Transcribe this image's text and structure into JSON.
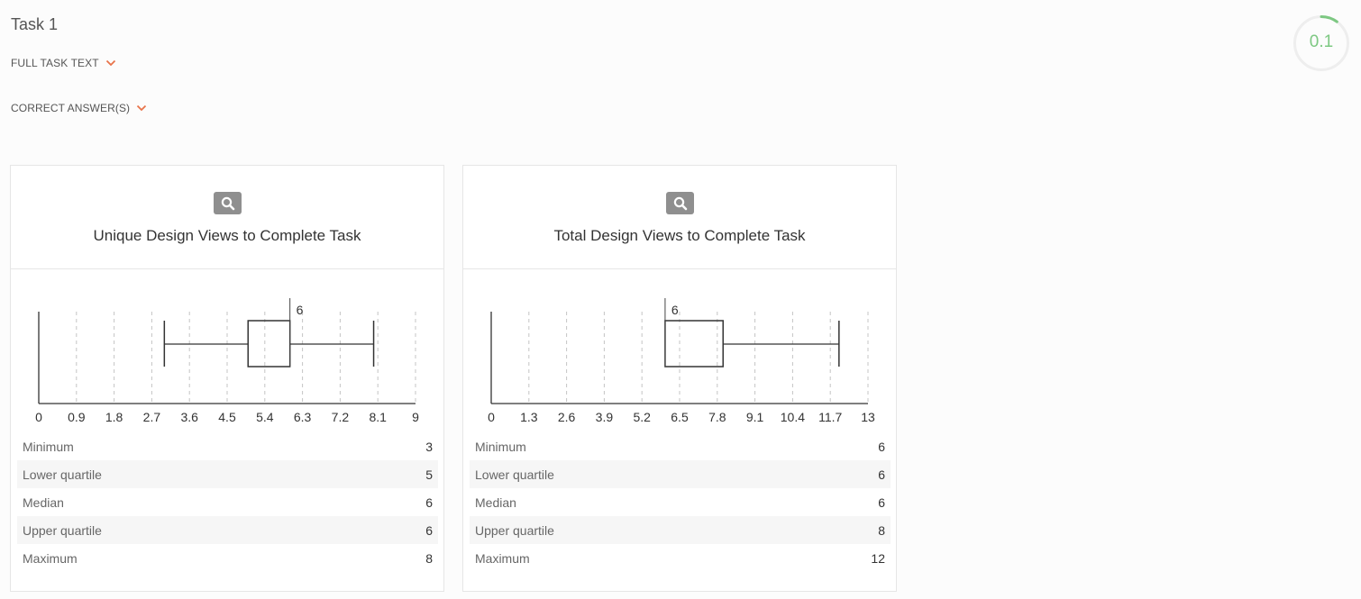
{
  "task": {
    "title": "Task 1",
    "full_task_text_label": "FULL TASK TEXT",
    "correct_answers_label": "CORRECT ANSWER(S)",
    "score": "0.1",
    "score_fraction": 0.1
  },
  "colors": {
    "accent": "#e8734a",
    "score": "#7dc882",
    "ring": "#eeeeee"
  },
  "cards": [
    {
      "title": "Unique Design Views to Complete Task",
      "zoom_icon": "search-icon",
      "stats": [
        {
          "label": "Minimum",
          "value": "3"
        },
        {
          "label": "Lower quartile",
          "value": "5"
        },
        {
          "label": "Median",
          "value": "6"
        },
        {
          "label": "Upper quartile",
          "value": "6"
        },
        {
          "label": "Maximum",
          "value": "8"
        }
      ]
    },
    {
      "title": "Total Design Views to Complete Task",
      "zoom_icon": "search-icon",
      "stats": [
        {
          "label": "Minimum",
          "value": "6"
        },
        {
          "label": "Lower quartile",
          "value": "6"
        },
        {
          "label": "Median",
          "value": "6"
        },
        {
          "label": "Upper quartile",
          "value": "8"
        },
        {
          "label": "Maximum",
          "value": "12"
        }
      ]
    }
  ],
  "chart_data": [
    {
      "type": "boxplot",
      "title": "Unique Design Views to Complete Task",
      "xlim": [
        0,
        9
      ],
      "ticks": [
        "0",
        "0.9",
        "1.8",
        "2.7",
        "3.6",
        "4.5",
        "5.4",
        "6.3",
        "7.2",
        "8.1",
        "9"
      ],
      "min": 3,
      "q1": 5,
      "median": 6,
      "q3": 6,
      "max": 8,
      "median_label": "6",
      "grid": true
    },
    {
      "type": "boxplot",
      "title": "Total Design Views to Complete Task",
      "xlim": [
        0,
        13
      ],
      "ticks": [
        "0",
        "1.3",
        "2.6",
        "3.9",
        "5.2",
        "6.5",
        "7.8",
        "9.1",
        "10.4",
        "11.7",
        "13"
      ],
      "min": 6,
      "q1": 6,
      "median": 6,
      "q3": 8,
      "max": 12,
      "median_label": "6",
      "grid": true
    }
  ]
}
